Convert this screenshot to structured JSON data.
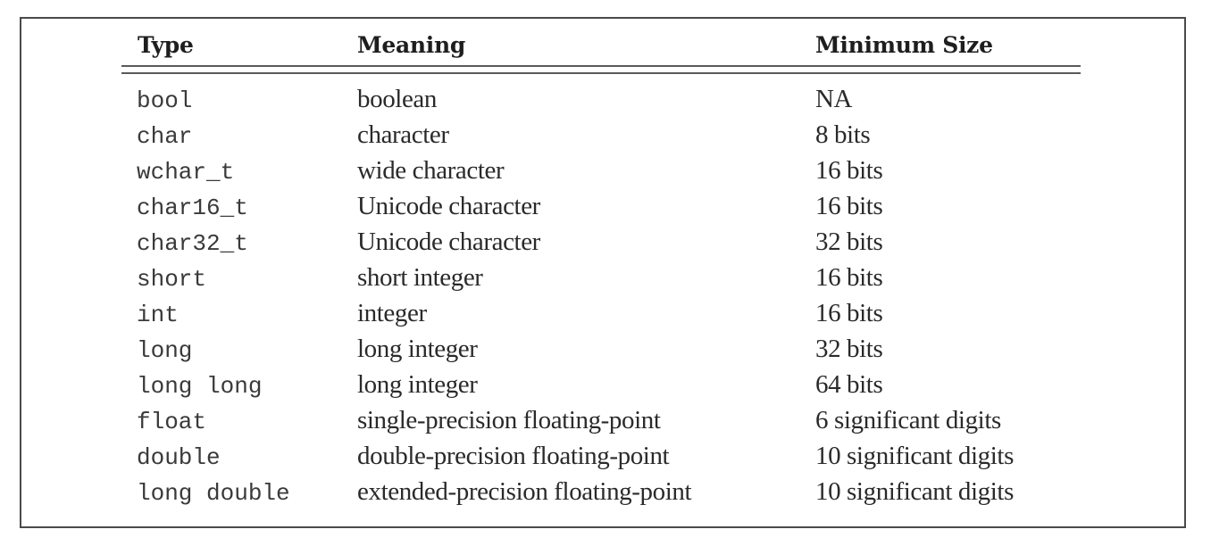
{
  "table": {
    "headers": {
      "type": "Type",
      "meaning": "Meaning",
      "size": "Minimum Size"
    },
    "rows": [
      {
        "type": "bool",
        "meaning": "boolean",
        "size": "NA"
      },
      {
        "type": "char",
        "meaning": "character",
        "size": "8 bits"
      },
      {
        "type": "wchar_t",
        "meaning": "wide character",
        "size": "16 bits"
      },
      {
        "type": "char16_t",
        "meaning": "Unicode character",
        "size": "16 bits"
      },
      {
        "type": "char32_t",
        "meaning": "Unicode character",
        "size": "32 bits"
      },
      {
        "type": "short",
        "meaning": "short integer",
        "size": "16 bits"
      },
      {
        "type": "int",
        "meaning": "integer",
        "size": "16 bits"
      },
      {
        "type": "long",
        "meaning": "long integer",
        "size": "32 bits"
      },
      {
        "type": "long long",
        "meaning": "long integer",
        "size": "64 bits"
      },
      {
        "type": "float",
        "meaning": "single-precision floating-point",
        "size": "6 significant digits"
      },
      {
        "type": "double",
        "meaning": "double-precision floating-point",
        "size": "10 significant digits"
      },
      {
        "type": "long double",
        "meaning": "extended-precision floating-point",
        "size": "10 significant digits"
      }
    ]
  }
}
